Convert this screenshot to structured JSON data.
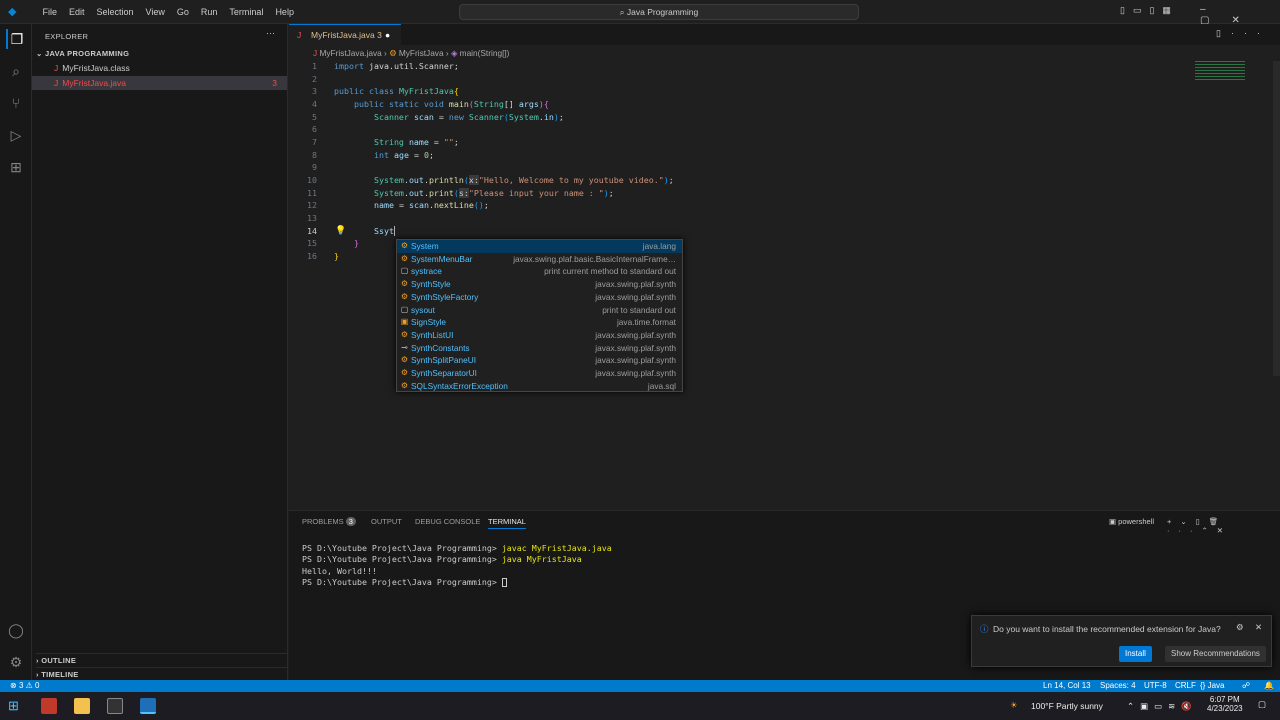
{
  "menu": [
    "File",
    "Edit",
    "Selection",
    "View",
    "Go",
    "Run",
    "Terminal",
    "Help"
  ],
  "search": "Java Programming",
  "sidebar": {
    "title": "EXPLORER",
    "folder": "JAVA PROGRAMMING",
    "files": [
      {
        "name": "MyFristJava.class",
        "badge": ""
      },
      {
        "name": "MyFristJava.java",
        "badge": "3"
      }
    ],
    "outline": "OUTLINE",
    "timeline": "TIMELINE"
  },
  "tab": {
    "name": "MyFristJava.java",
    "badge": "3"
  },
  "breadcrumb": [
    "MyFristJava.java",
    "MyFristJava",
    "main(String[])"
  ],
  "code": [
    [
      [
        "import ",
        "kw"
      ],
      [
        "java.util.Scanner",
        "pl"
      ],
      [
        ";",
        "pl"
      ]
    ],
    [],
    [
      [
        "public class ",
        "kw"
      ],
      [
        "MyFristJava",
        "ty"
      ],
      [
        "{",
        "br"
      ]
    ],
    [
      [
        "    public static void ",
        "kw"
      ],
      [
        "main",
        "fn"
      ],
      [
        "(",
        "br2"
      ],
      [
        "String",
        "ty"
      ],
      [
        "[] ",
        "pl"
      ],
      [
        "args",
        "va"
      ],
      [
        ")",
        "br2"
      ],
      [
        "{",
        "br2"
      ]
    ],
    [
      [
        "        Scanner ",
        "ty"
      ],
      [
        "scan",
        "va"
      ],
      [
        " = ",
        "pl"
      ],
      [
        "new ",
        "kw"
      ],
      [
        "Scanner",
        "ty"
      ],
      [
        "(",
        "br3"
      ],
      [
        "System",
        "ty"
      ],
      [
        ".",
        "pl"
      ],
      [
        "in",
        "va"
      ],
      [
        ")",
        "br3"
      ],
      [
        ";",
        "pl"
      ]
    ],
    [],
    [
      [
        "        String ",
        "ty"
      ],
      [
        "name",
        "va"
      ],
      [
        " = ",
        "pl"
      ],
      [
        "\"\"",
        "st"
      ],
      [
        ";",
        "pl"
      ]
    ],
    [
      [
        "        int ",
        "kw"
      ],
      [
        "age",
        "va"
      ],
      [
        " = ",
        "pl"
      ],
      [
        "0",
        "nu"
      ],
      [
        ";",
        "pl"
      ]
    ],
    [],
    [
      [
        "        System",
        "ty"
      ],
      [
        ".",
        "pl"
      ],
      [
        "out",
        "va"
      ],
      [
        ".",
        "pl"
      ],
      [
        "println",
        "fn"
      ],
      [
        "(",
        "br3"
      ],
      [
        "x:",
        "hint"
      ],
      [
        "\"Hello, Welcome to my youtube video.\"",
        "st"
      ],
      [
        ")",
        "br3"
      ],
      [
        ";",
        "pl"
      ]
    ],
    [
      [
        "        System",
        "ty"
      ],
      [
        ".",
        "pl"
      ],
      [
        "out",
        "va"
      ],
      [
        ".",
        "pl"
      ],
      [
        "print",
        "fn"
      ],
      [
        "(",
        "br3"
      ],
      [
        "s:",
        "hint"
      ],
      [
        "\"Please input your name : \"",
        "st"
      ],
      [
        ")",
        "br3"
      ],
      [
        ";",
        "pl"
      ]
    ],
    [
      [
        "        name",
        "va"
      ],
      [
        " = ",
        "pl"
      ],
      [
        "scan",
        "va"
      ],
      [
        ".",
        "pl"
      ],
      [
        "nextLine",
        "fn"
      ],
      [
        "()",
        "br3"
      ],
      [
        ";",
        "pl"
      ]
    ],
    [],
    [
      [
        "        Ssyt",
        "va"
      ]
    ],
    [
      [
        "    }",
        "br2"
      ]
    ],
    [
      [
        "}",
        "br"
      ]
    ]
  ],
  "suggestions": [
    {
      "label": "System",
      "detail": "java.lang",
      "icon": "class"
    },
    {
      "label": "SystemMenuBar",
      "detail": "javax.swing.plaf.basic.BasicInternalFrame…",
      "icon": "class"
    },
    {
      "label": "systrace",
      "detail": "print current method to standard out",
      "icon": "snippet"
    },
    {
      "label": "SynthStyle",
      "detail": "javax.swing.plaf.synth",
      "icon": "class"
    },
    {
      "label": "SynthStyleFactory",
      "detail": "javax.swing.plaf.synth",
      "icon": "class"
    },
    {
      "label": "sysout",
      "detail": "print to standard out",
      "icon": "snippet"
    },
    {
      "label": "SignStyle",
      "detail": "java.time.format",
      "icon": "enum"
    },
    {
      "label": "SynthListUI",
      "detail": "javax.swing.plaf.synth",
      "icon": "class"
    },
    {
      "label": "SynthConstants",
      "detail": "javax.swing.plaf.synth",
      "icon": "interface"
    },
    {
      "label": "SynthSplitPaneUI",
      "detail": "javax.swing.plaf.synth",
      "icon": "class"
    },
    {
      "label": "SynthSeparatorUI",
      "detail": "javax.swing.plaf.synth",
      "icon": "class"
    },
    {
      "label": "SQLSyntaxErrorException",
      "detail": "java.sql",
      "icon": "class"
    }
  ],
  "panel": {
    "tabs": [
      "PROBLEMS",
      "OUTPUT",
      "DEBUG CONSOLE",
      "TERMINAL"
    ],
    "problems_count": "3",
    "shell": "powershell",
    "terminal": [
      [
        "PS D:\\Youtube Project\\Java Programming> ",
        "javac MyFristJava.java"
      ],
      [
        "PS D:\\Youtube Project\\Java Programming> ",
        "java MyFristJava"
      ],
      [
        "Hello, World!!!",
        ""
      ],
      [
        "PS D:\\Youtube Project\\Java Programming> ",
        ""
      ]
    ]
  },
  "notification": {
    "message": "Do you want to install the recommended extension for Java?",
    "install": "Install",
    "show": "Show Recommendations"
  },
  "status": {
    "errors": "3",
    "warnings": "0",
    "position": "Ln 14, Col 13",
    "spaces": "Spaces: 4",
    "encoding": "UTF-8",
    "eol": "CRLF",
    "language": "Java"
  },
  "taskbar": {
    "weather": "100°F  Partly sunny",
    "time": "6:07 PM",
    "date": "4/23/2023"
  }
}
